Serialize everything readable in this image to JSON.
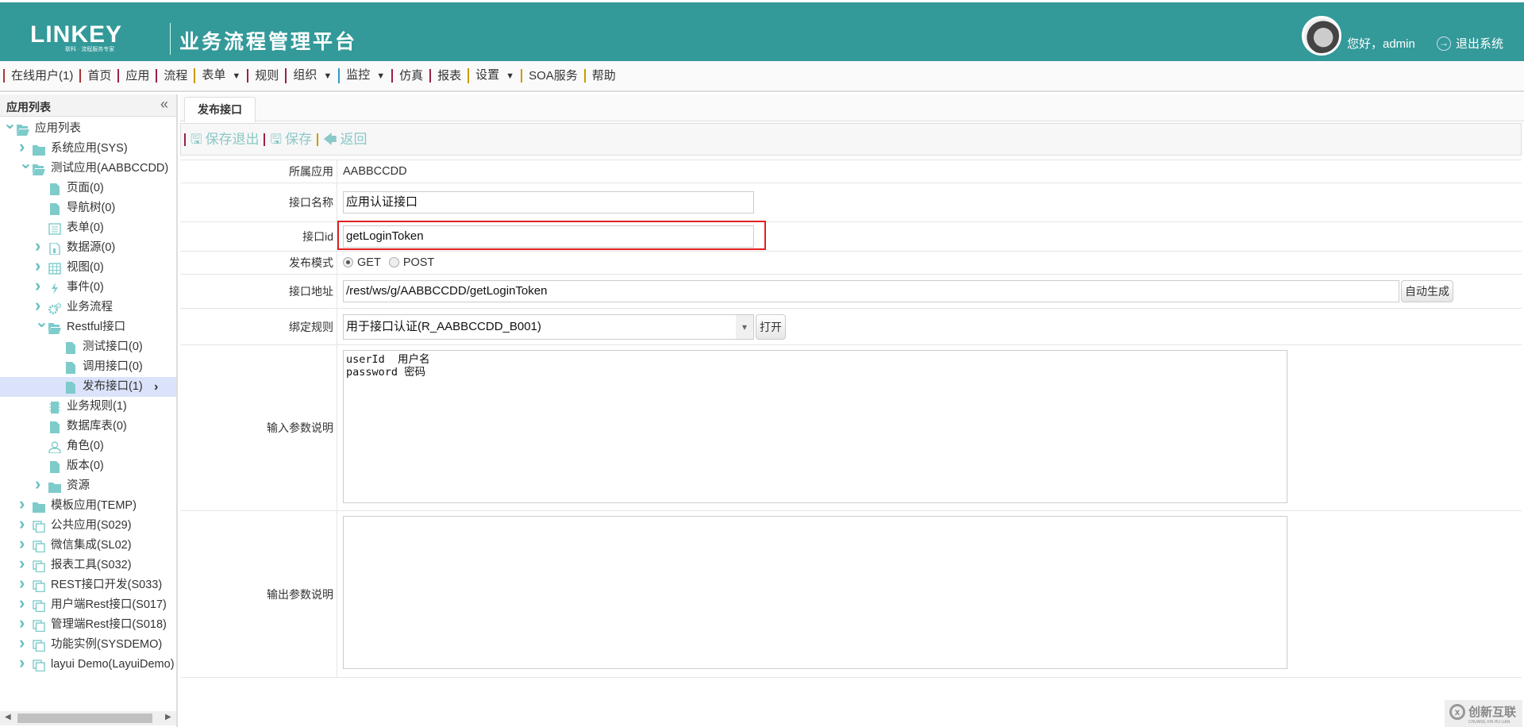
{
  "header": {
    "logo": "LINKEY",
    "logo_sub": "联科 · 流程服务专家",
    "title": "业务流程管理平台",
    "greeting": "您好，admin",
    "logout": "退出系统"
  },
  "nav": [
    {
      "label": "在线用户(1)"
    },
    {
      "label": "首页"
    },
    {
      "label": "应用"
    },
    {
      "label": "流程"
    },
    {
      "label": "表单",
      "dropdown": true
    },
    {
      "label": "规则"
    },
    {
      "label": "组织",
      "dropdown": true
    },
    {
      "label": "监控",
      "dropdown": true
    },
    {
      "label": "仿真"
    },
    {
      "label": "报表"
    },
    {
      "label": "设置",
      "dropdown": true
    },
    {
      "label": "SOA服务"
    },
    {
      "label": "帮助"
    }
  ],
  "sidebar": {
    "title": "应用列表",
    "tree": [
      {
        "label": "应用列表",
        "level": 0,
        "state": "open",
        "icon": "folder-open"
      },
      {
        "label": "系统应用(SYS)",
        "level": 1,
        "state": "closed",
        "icon": "folder"
      },
      {
        "label": "测试应用(AABBCCDD)",
        "level": 1,
        "state": "open",
        "icon": "folder-open"
      },
      {
        "label": "页面(0)",
        "level": 2,
        "state": "leaf",
        "icon": "file"
      },
      {
        "label": "导航树(0)",
        "level": 2,
        "state": "leaf",
        "icon": "file"
      },
      {
        "label": "表单(0)",
        "level": 2,
        "state": "leaf",
        "icon": "form"
      },
      {
        "label": "数据源(0)",
        "level": 2,
        "state": "closed",
        "icon": "datasource"
      },
      {
        "label": "视图(0)",
        "level": 2,
        "state": "closed",
        "icon": "grid"
      },
      {
        "label": "事件(0)",
        "level": 2,
        "state": "closed",
        "icon": "bolt"
      },
      {
        "label": "业务流程",
        "level": 2,
        "state": "closed",
        "icon": "gears"
      },
      {
        "label": "Restful接口",
        "level": 2,
        "state": "open",
        "icon": "folder-open"
      },
      {
        "label": "测试接口(0)",
        "level": 3,
        "state": "leaf",
        "icon": "file"
      },
      {
        "label": "调用接口(0)",
        "level": 3,
        "state": "leaf",
        "icon": "file"
      },
      {
        "label": "发布接口(1)",
        "level": 3,
        "state": "leaf",
        "icon": "file",
        "selected": true
      },
      {
        "label": "业务规则(1)",
        "level": 2,
        "state": "leaf",
        "icon": "rule"
      },
      {
        "label": "数据库表(0)",
        "level": 2,
        "state": "leaf",
        "icon": "file"
      },
      {
        "label": "角色(0)",
        "level": 2,
        "state": "leaf",
        "icon": "user"
      },
      {
        "label": "版本(0)",
        "level": 2,
        "state": "leaf",
        "icon": "file"
      },
      {
        "label": "资源",
        "level": 2,
        "state": "closed",
        "icon": "folder"
      },
      {
        "label": "模板应用(TEMP)",
        "level": 1,
        "state": "closed",
        "icon": "folder"
      },
      {
        "label": "公共应用(S029)",
        "level": 1,
        "state": "closed",
        "icon": "copy"
      },
      {
        "label": "微信集成(SL02)",
        "level": 1,
        "state": "closed",
        "icon": "copy"
      },
      {
        "label": "报表工具(S032)",
        "level": 1,
        "state": "closed",
        "icon": "copy"
      },
      {
        "label": "REST接口开发(S033)",
        "level": 1,
        "state": "closed",
        "icon": "copy"
      },
      {
        "label": "用户端Rest接口(S017)",
        "level": 1,
        "state": "closed",
        "icon": "copy"
      },
      {
        "label": "管理端Rest接口(S018)",
        "level": 1,
        "state": "closed",
        "icon": "copy"
      },
      {
        "label": "功能实例(SYSDEMO)",
        "level": 1,
        "state": "closed",
        "icon": "copy"
      },
      {
        "label": "layui Demo(LayuiDemo)",
        "level": 1,
        "state": "closed",
        "icon": "copy"
      }
    ]
  },
  "main": {
    "tab": "发布接口",
    "toolbar": {
      "save_exit": "保存退出",
      "save": "保存",
      "back": "返回"
    },
    "form": {
      "app_label": "所属应用",
      "app_value": "AABBCCDD",
      "name_label": "接口名称",
      "name_value": "应用认证接口",
      "id_label": "接口id",
      "id_value": "getLoginToken",
      "mode_label": "发布模式",
      "mode_get": "GET",
      "mode_post": "POST",
      "mode_selected": "GET",
      "url_label": "接口地址",
      "url_value": "/rest/ws/g/AABBCCDD/getLoginToken",
      "auto_gen": "自动生成",
      "rule_label": "绑定规则",
      "rule_value": "用于接口认证(R_AABBCCDD_B001)",
      "open": "打开",
      "input_label": "输入参数说明",
      "input_value": "userId  用户名\npassword 密码",
      "output_label": "输出参数说明",
      "output_value": ""
    }
  },
  "watermark": {
    "text": "创新互联",
    "en": "CHUANG XIN HU LIAN"
  },
  "colors": {
    "header": "#339999",
    "icon": "#7ecbcb",
    "highlight": "#e02020"
  }
}
